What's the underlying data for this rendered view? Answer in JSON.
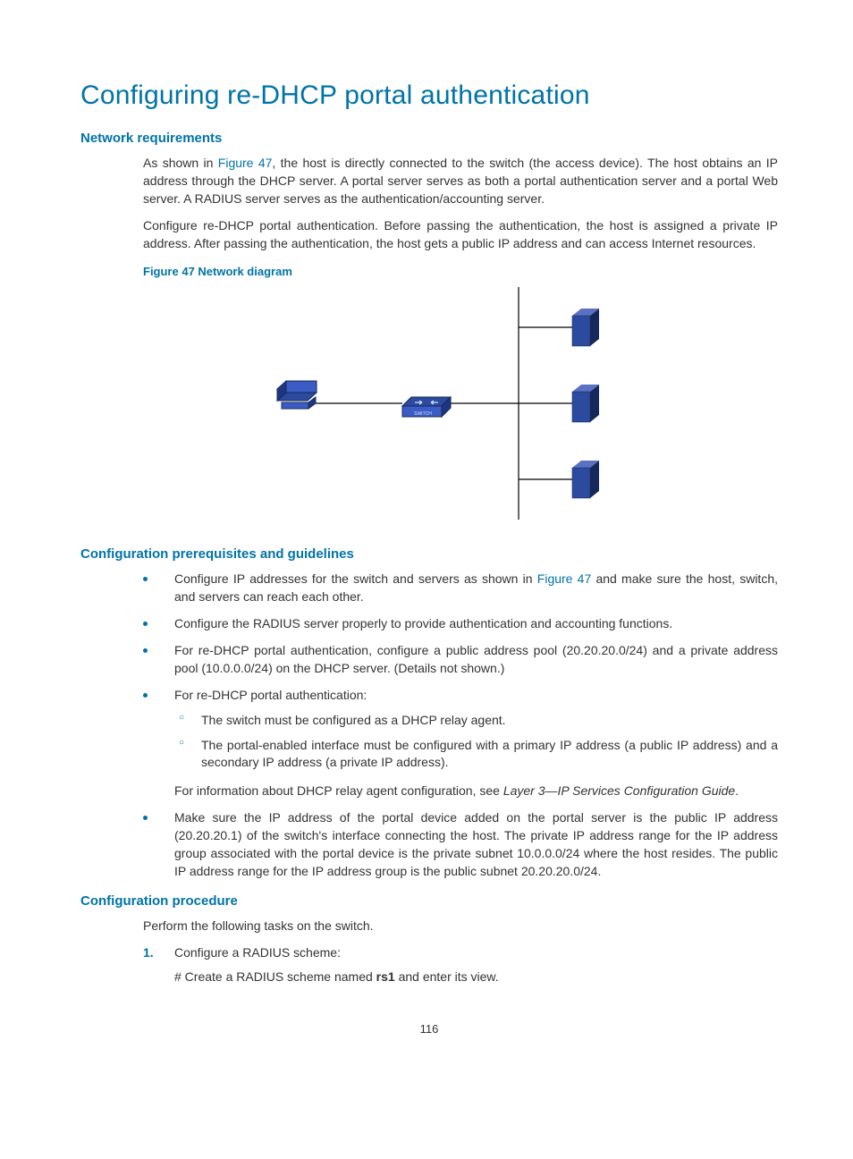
{
  "title": "Configuring re-DHCP portal authentication",
  "sections": {
    "network_req": {
      "heading": "Network requirements",
      "p1_a": "As shown in ",
      "p1_link": "Figure 47",
      "p1_b": ", the host is directly connected to the switch (the access device). The host obtains an IP address through the DHCP server. A portal server serves as both a portal authentication server and a portal Web server. A RADIUS server serves as the authentication/accounting server.",
      "p2": "Configure re-DHCP portal authentication. Before passing the authentication, the host is assigned a private IP address. After passing the authentication, the host gets a public IP address and can access Internet resources.",
      "fig_caption": "Figure 47 Network diagram"
    },
    "prereq": {
      "heading": "Configuration prerequisites and guidelines",
      "b1_a": "Configure IP addresses for the switch and servers as shown in ",
      "b1_link": "Figure 47",
      "b1_b": " and make sure the host, switch, and servers can reach each other.",
      "b2": "Configure the RADIUS server properly to provide authentication and accounting functions.",
      "b3": "For re-DHCP portal authentication, configure a public address pool (20.20.20.0/24) and a private address pool (10.0.0.0/24) on the DHCP server. (Details not shown.)",
      "b4": "For re-DHCP portal authentication:",
      "b4_s1": "The switch must be configured as a DHCP relay agent.",
      "b4_s2": "The portal-enabled interface must be configured with a primary IP address (a public IP address) and a secondary IP address (a private IP address).",
      "b4_note_a": "For information about DHCP relay agent configuration, see ",
      "b4_note_i": "Layer 3—IP Services Configuration Guide",
      "b4_note_b": ".",
      "b5": "Make sure the IP address of the portal device added on the portal server is the public IP address (20.20.20.1) of the switch's interface connecting the host. The private IP address range for the IP address group associated with the portal device is the private subnet 10.0.0.0/24 where the host resides. The public IP address range for the IP address group is the public subnet 20.20.20.0/24."
    },
    "proc": {
      "heading": "Configuration procedure",
      "intro": "Perform the following tasks on the switch.",
      "s1": "Configure a RADIUS scheme:",
      "s1_a": "# Create a RADIUS scheme named ",
      "s1_bold": "rs1",
      "s1_b": " and enter its view."
    }
  },
  "page_number": "116"
}
